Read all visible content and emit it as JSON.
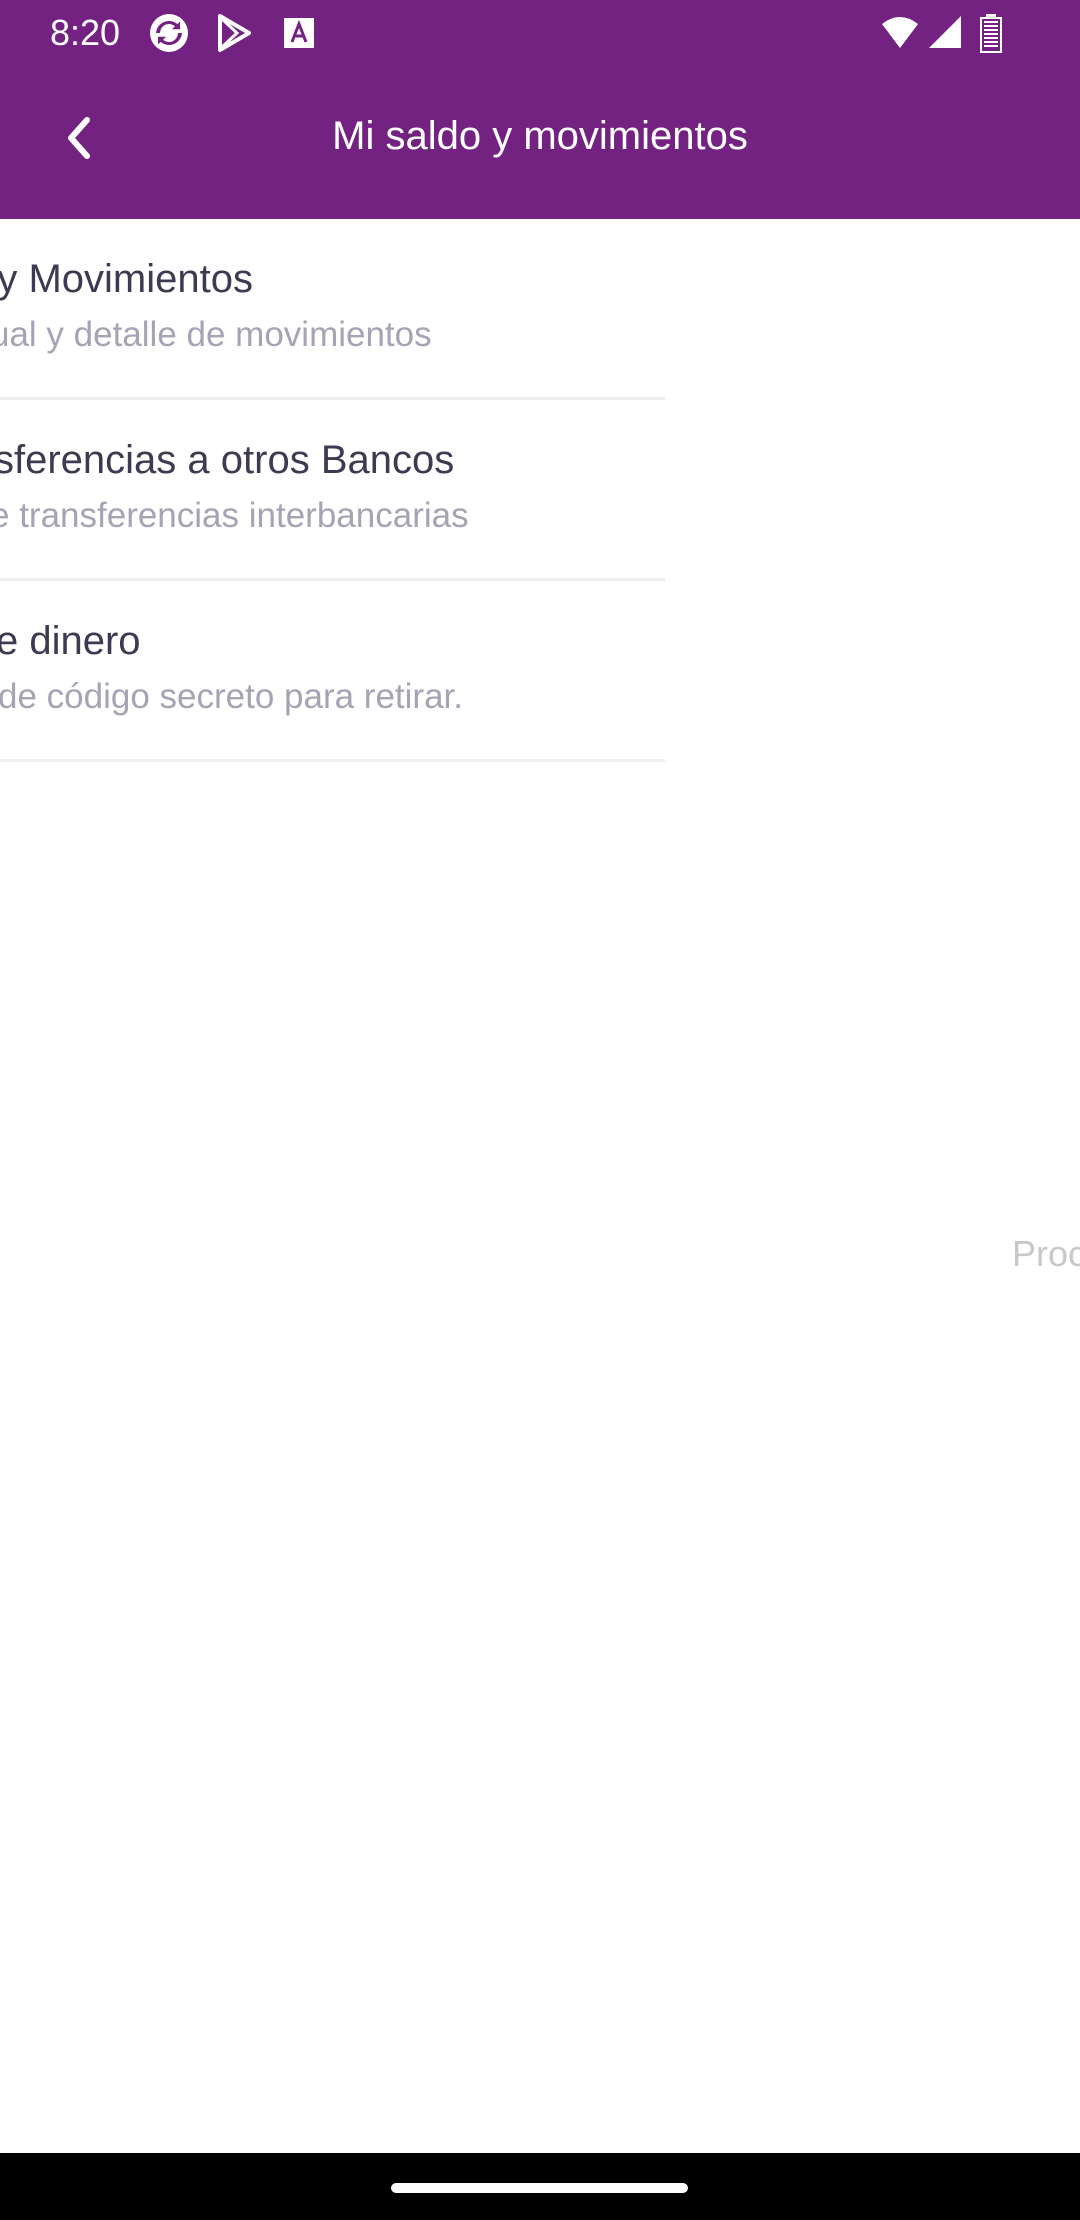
{
  "status_bar": {
    "time": "8:20",
    "icons": [
      "sync-app-icon",
      "play-store-icon",
      "font-app-icon",
      "wifi-icon",
      "cellular-signal-icon",
      "battery-icon"
    ]
  },
  "app_bar": {
    "title": "Mi saldo y movimientos",
    "back_icon": "chevron-left-icon",
    "background": "#732281"
  },
  "menu": {
    "items": [
      {
        "title": "o y Movimientos",
        "subtitle": "ual y detalle de movimientos"
      },
      {
        "title": "sferencias a otros Bancos",
        "subtitle": "e transferencias interbancarias"
      },
      {
        "title": "e dinero",
        "subtitle": "de código secreto para retirar."
      }
    ]
  },
  "peek_text": "Proc",
  "colors": {
    "title_text": "#3d3a51",
    "subtitle_text": "#a6a3b5",
    "divider": "#eeeeee"
  }
}
